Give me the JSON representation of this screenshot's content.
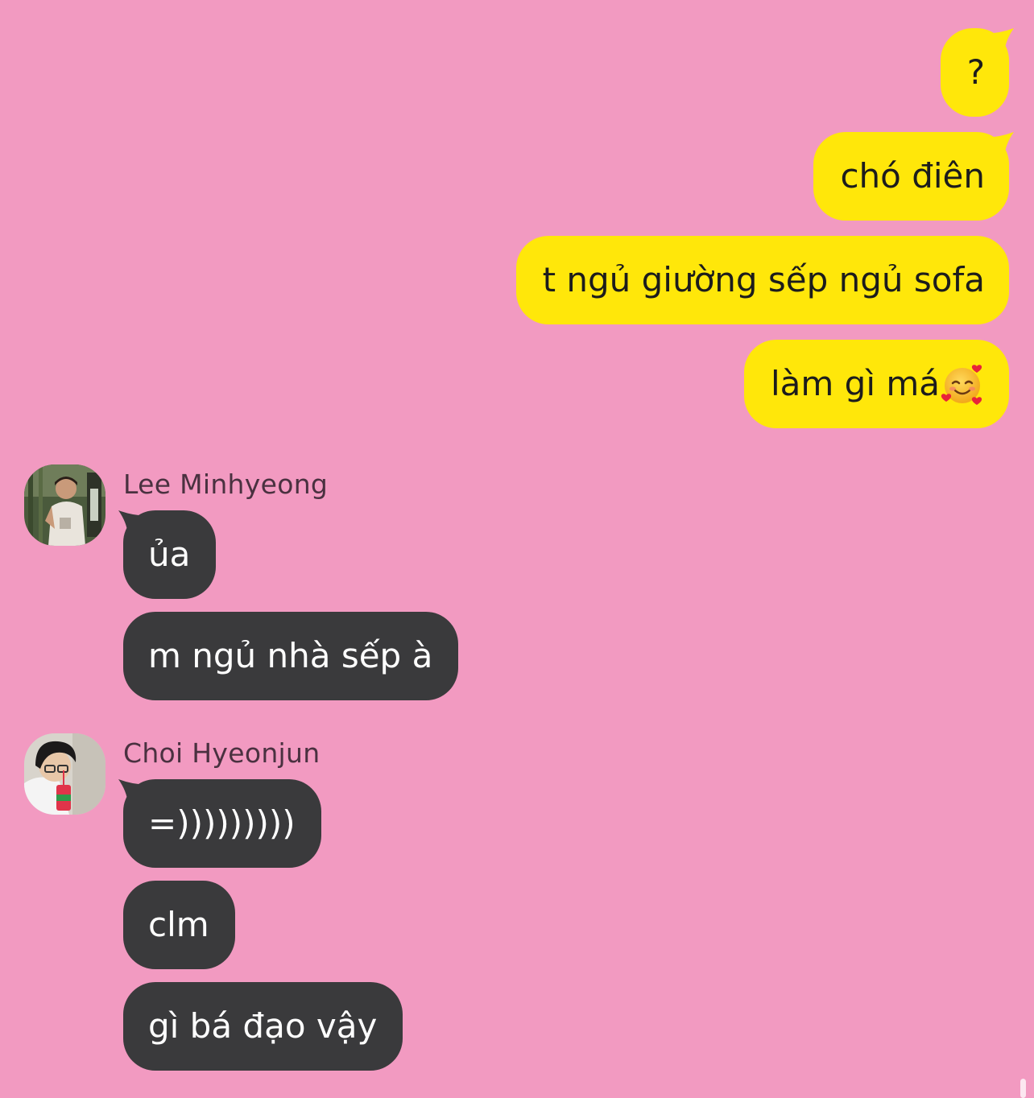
{
  "outgoing": [
    {
      "text": "?"
    },
    {
      "text": "chó điên"
    },
    {
      "text": "t ngủ giường sếp ngủ sofa"
    },
    {
      "text": "làm gì má",
      "emoji": "smiling-face-with-hearts"
    }
  ],
  "groups": [
    {
      "sender": "Lee Minhyeong",
      "messages": [
        "ủa",
        "m ngủ nhà sếp à"
      ]
    },
    {
      "sender": "Choi Hyeonjun",
      "messages": [
        "=)))))))))",
        "clm",
        "gì bá đạo vậy"
      ]
    }
  ],
  "colors": {
    "background": "#f29ac1",
    "outgoing_bubble": "#ffe70a",
    "incoming_bubble": "#3a3a3c"
  }
}
